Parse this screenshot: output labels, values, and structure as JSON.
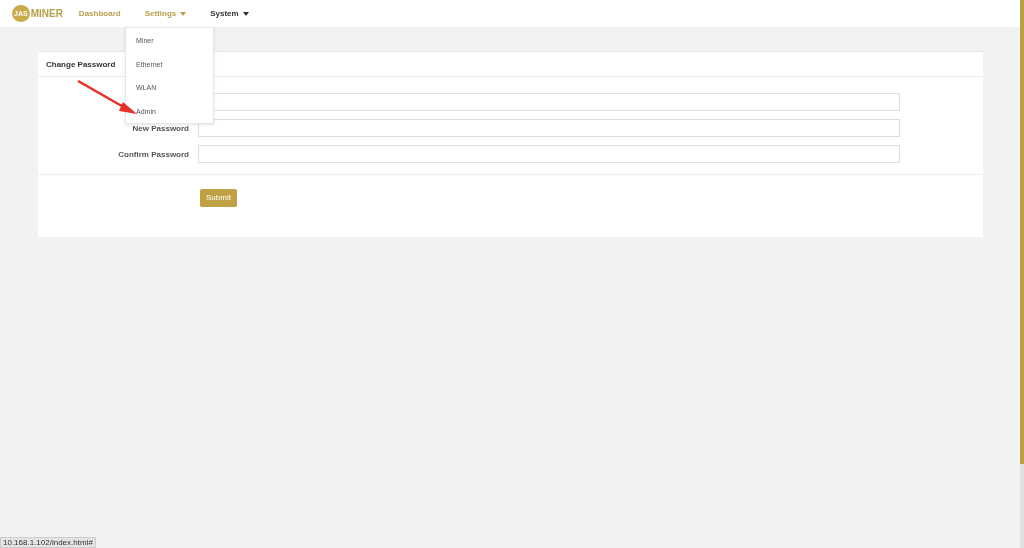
{
  "brand": {
    "logo": "JAS",
    "name": "MINER"
  },
  "nav": [
    {
      "label": "Dashboard",
      "color": "#b8a04a",
      "dropdown": false
    },
    {
      "label": "Settings",
      "color": "#b8a04a",
      "dropdown": true
    },
    {
      "label": "System",
      "color": "#333333",
      "dropdown": true
    }
  ],
  "menu": {
    "items": [
      "Miner",
      "Ethernet",
      "WLAN",
      "Admin"
    ]
  },
  "panel": {
    "title": "Change Password",
    "fields": [
      {
        "kind": "password"
      },
      {
        "kind": "password",
        "label": "New Password"
      },
      {
        "kind": "password",
        "label": "Confirm Password"
      }
    ],
    "submit": "Submit"
  },
  "status_bar": "10.168.1.102/index.html#"
}
